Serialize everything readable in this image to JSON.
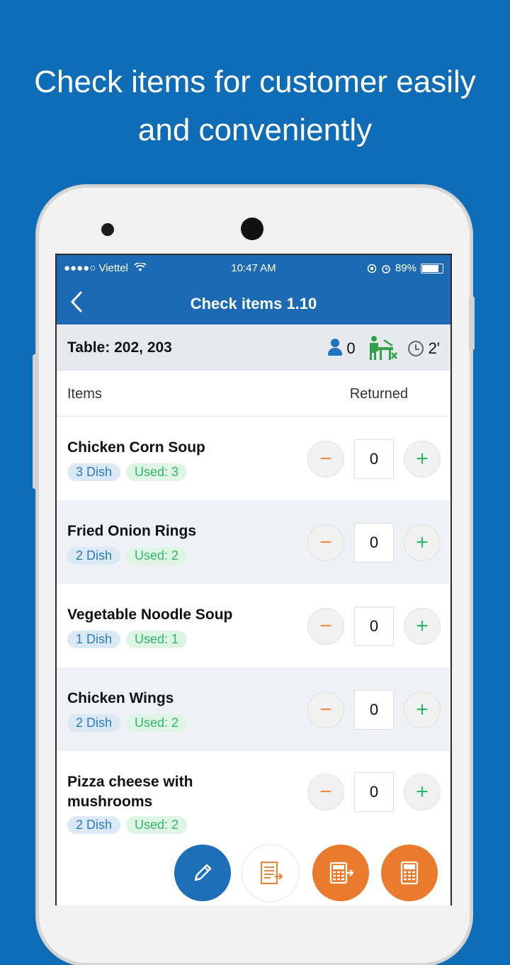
{
  "headline": {
    "line1": "Check items for customer easily",
    "line2": "and conveniently"
  },
  "status_bar": {
    "carrier": "●●●●○ Viettel",
    "time": "10:47 AM",
    "battery": "89%",
    "battery_level": 0.89
  },
  "navbar": {
    "back_icon": "chevron-left-icon",
    "title": "Check items 1.10"
  },
  "table_info": {
    "label": "Table: 202, 203",
    "guests": "0",
    "duration": "2'"
  },
  "columns": {
    "items": "Items",
    "returned": "Returned"
  },
  "items": [
    {
      "name": "Chicken Corn Soup",
      "dish": "3 Dish",
      "used": "Used: 3",
      "qty": "0"
    },
    {
      "name": "Fried Onion Rings",
      "dish": "2 Dish",
      "used": "Used: 2",
      "qty": "0"
    },
    {
      "name": "Vegetable Noodle Soup",
      "dish": "1 Dish",
      "used": "Used: 1",
      "qty": "0"
    },
    {
      "name": "Chicken Wings",
      "dish": "2 Dish",
      "used": "Used: 2",
      "qty": "0"
    },
    {
      "name": "Pizza cheese with mushrooms",
      "dish": "2 Dish",
      "used": "Used: 2",
      "qty": "0"
    }
  ],
  "controls": {
    "minus": "−",
    "plus": "+"
  },
  "fabs": [
    "pencil-icon",
    "document-send-icon",
    "calculator-send-icon",
    "calculator-icon"
  ],
  "colors": {
    "background": "#0f6cb6",
    "header": "#1b6ab3",
    "minus": "#f08a3c",
    "plus": "#2fb56a",
    "fab_orange": "#ea7a2c",
    "fab_blue": "#1e6fb9"
  }
}
